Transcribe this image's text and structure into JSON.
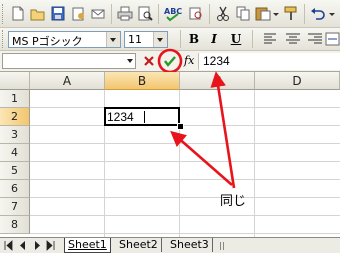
{
  "toolbar": {
    "font_name": "MS Pゴシック",
    "font_size": "11",
    "bold": "B",
    "italic": "I",
    "underline": "U"
  },
  "formula_bar": {
    "name_box": "",
    "fx_label": "fx",
    "formula_value": "1234"
  },
  "grid": {
    "columns": [
      "A",
      "B",
      "C",
      "D"
    ],
    "rows": [
      "1",
      "2",
      "3",
      "4",
      "5",
      "6",
      "7",
      "8"
    ],
    "active_cell_value": "1234"
  },
  "annotation": {
    "label": "同じ",
    "color": "#e8141b"
  },
  "sheet_tabs": [
    "Sheet1",
    "Sheet2",
    "Sheet3"
  ]
}
